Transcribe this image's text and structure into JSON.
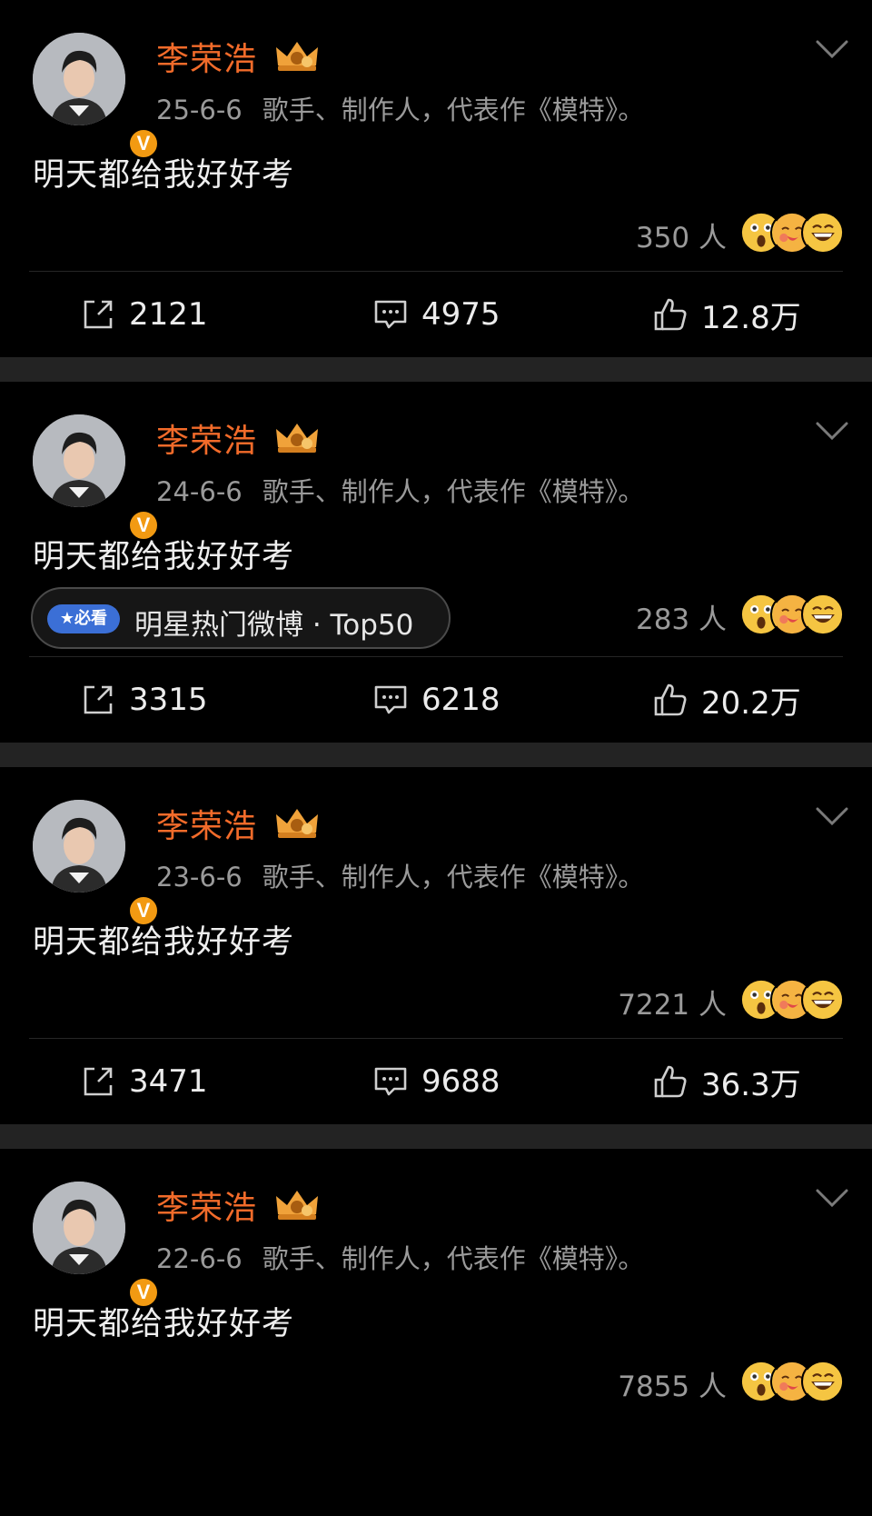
{
  "posts": [
    {
      "author": "李荣浩",
      "date": "25-6-6",
      "bio": "歌手、制作人，代表作《模特》。",
      "text": "明天都给我好好考",
      "reaction_count": "350 人",
      "reposts": "2121",
      "comments": "4975",
      "likes": "12.8万"
    },
    {
      "author": "李荣浩",
      "date": "24-6-6",
      "bio": "歌手、制作人，代表作《模特》。",
      "text": "明天都给我好好考",
      "tag": {
        "pill": "★必看",
        "label": "明星热门微博 · Top50"
      },
      "reaction_count": "283 人",
      "reposts": "3315",
      "comments": "6218",
      "likes": "20.2万"
    },
    {
      "author": "李荣浩",
      "date": "23-6-6",
      "bio": "歌手、制作人，代表作《模特》。",
      "text": "明天都给我好好考",
      "reaction_count": "7221 人",
      "reposts": "3471",
      "comments": "9688",
      "likes": "36.3万"
    },
    {
      "author": "李荣浩",
      "date": "22-6-6",
      "bio": "歌手、制作人，代表作《模特》。",
      "text": "明天都给我好好考",
      "reaction_count": "7855 人"
    }
  ],
  "verified_badge": "V",
  "colors": {
    "background": "#000000",
    "username": "#f26b2a",
    "meta": "#9a9a9a",
    "separator": "#232323",
    "badge": "#f29a12",
    "tag_pill": "#3b6fd6"
  },
  "icons": [
    "crown-icon",
    "chevron-down-icon",
    "repost-icon",
    "comment-icon",
    "like-icon",
    "surprised-emoji-icon",
    "love-emoji-icon",
    "laugh-emoji-icon"
  ]
}
